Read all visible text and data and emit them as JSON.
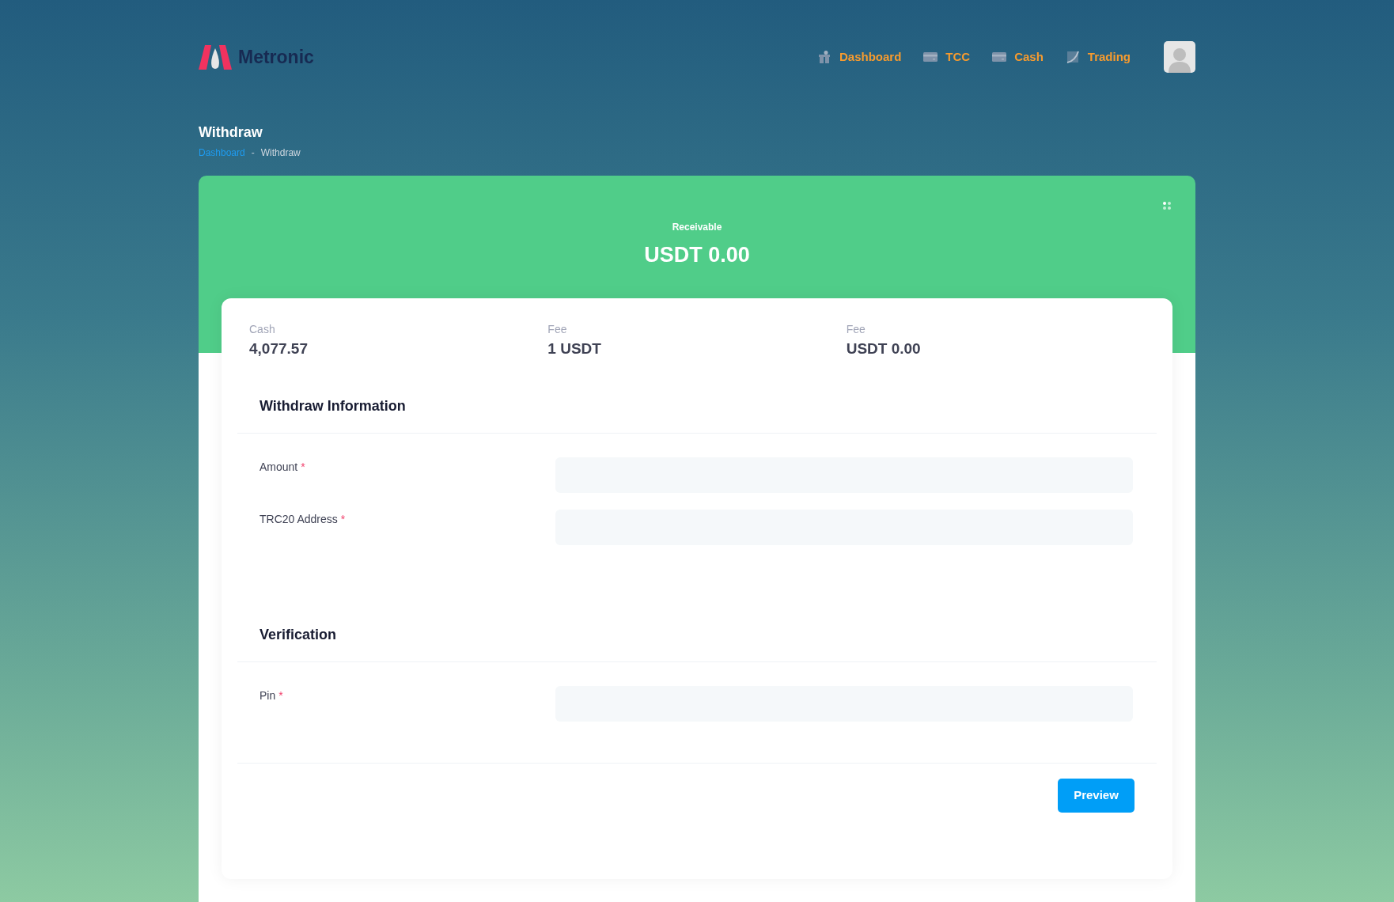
{
  "brand": {
    "name": "Metronic"
  },
  "nav": [
    {
      "label": "Dashboard"
    },
    {
      "label": "TCC"
    },
    {
      "label": "Cash"
    },
    {
      "label": "Trading"
    }
  ],
  "page": {
    "title": "Withdraw",
    "breadcrumb_separator": "-",
    "breadcrumb": [
      {
        "label": "Dashboard",
        "link": true
      },
      {
        "label": "Withdraw",
        "link": false
      }
    ]
  },
  "summary": {
    "label": "Receivable",
    "value": "USDT 0.00"
  },
  "stats": [
    {
      "label": "Cash",
      "value": "4,077.57"
    },
    {
      "label": "Fee",
      "value": "1 USDT"
    },
    {
      "label": "Fee",
      "value": "USDT 0.00"
    }
  ],
  "sections": [
    {
      "title": "Withdraw Information",
      "fields": [
        {
          "label": "Amount",
          "required_mark": "*"
        },
        {
          "label": "TRC20 Address",
          "required_mark": "*"
        }
      ]
    },
    {
      "title": "Verification",
      "fields": [
        {
          "label": "Pin",
          "required_mark": "*"
        }
      ]
    }
  ],
  "submit": {
    "label": "Preview"
  }
}
